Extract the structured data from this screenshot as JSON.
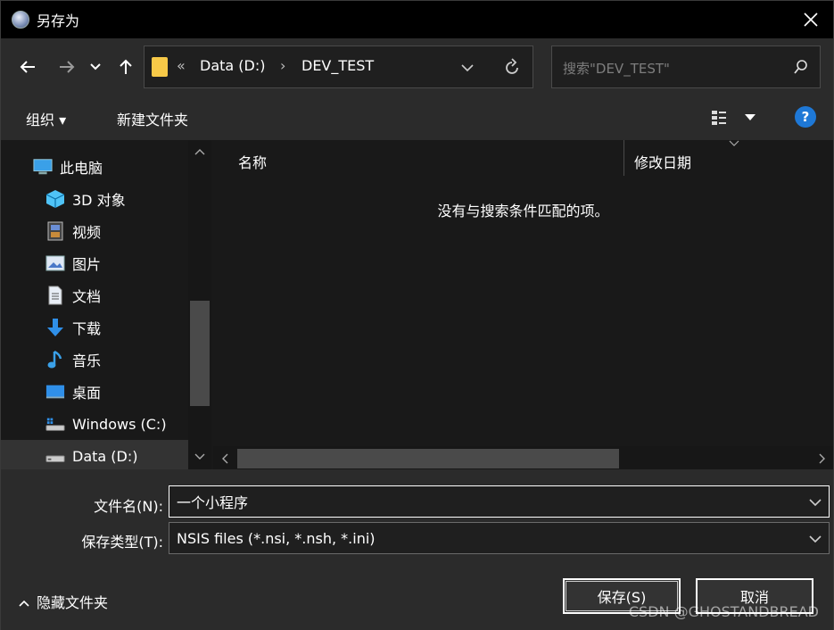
{
  "window": {
    "title": "另存为"
  },
  "nav": {
    "breadcrumb_overflow": "«",
    "crumbs": [
      "Data (D:)",
      "DEV_TEST"
    ],
    "search_placeholder": "搜索\"DEV_TEST\""
  },
  "toolbar": {
    "organize": "组织 ▾",
    "new_folder": "新建文件夹",
    "help": "?"
  },
  "sidebar": {
    "items": [
      {
        "label": "此电脑",
        "icon": "computer-icon"
      },
      {
        "label": "3D 对象",
        "icon": "cube-icon"
      },
      {
        "label": "视频",
        "icon": "video-icon"
      },
      {
        "label": "图片",
        "icon": "picture-icon"
      },
      {
        "label": "文档",
        "icon": "document-icon"
      },
      {
        "label": "下载",
        "icon": "download-icon"
      },
      {
        "label": "音乐",
        "icon": "music-icon"
      },
      {
        "label": "桌面",
        "icon": "desktop-icon"
      },
      {
        "label": "Windows (C:)",
        "icon": "drive-c-icon"
      },
      {
        "label": "Data (D:)",
        "icon": "drive-d-icon"
      }
    ]
  },
  "filelist": {
    "columns": [
      "名称",
      "修改日期"
    ],
    "empty_message": "没有与搜索条件匹配的项。"
  },
  "form": {
    "filename_label": "文件名(N):",
    "filename_value": "一个小程序",
    "filetype_label": "保存类型(T):",
    "filetype_value": "NSIS files (*.nsi, *.nsh, *.ini)"
  },
  "footer": {
    "hide_folders": "隐藏文件夹",
    "save_label": "保存(S)",
    "cancel_label": "取消",
    "watermark": "CSDN @GHOSTANDBREAD"
  },
  "colors": {
    "accent": "#1e78d6",
    "folder": "#f7c948",
    "background": "#191919",
    "panel": "#2b2b2b"
  }
}
